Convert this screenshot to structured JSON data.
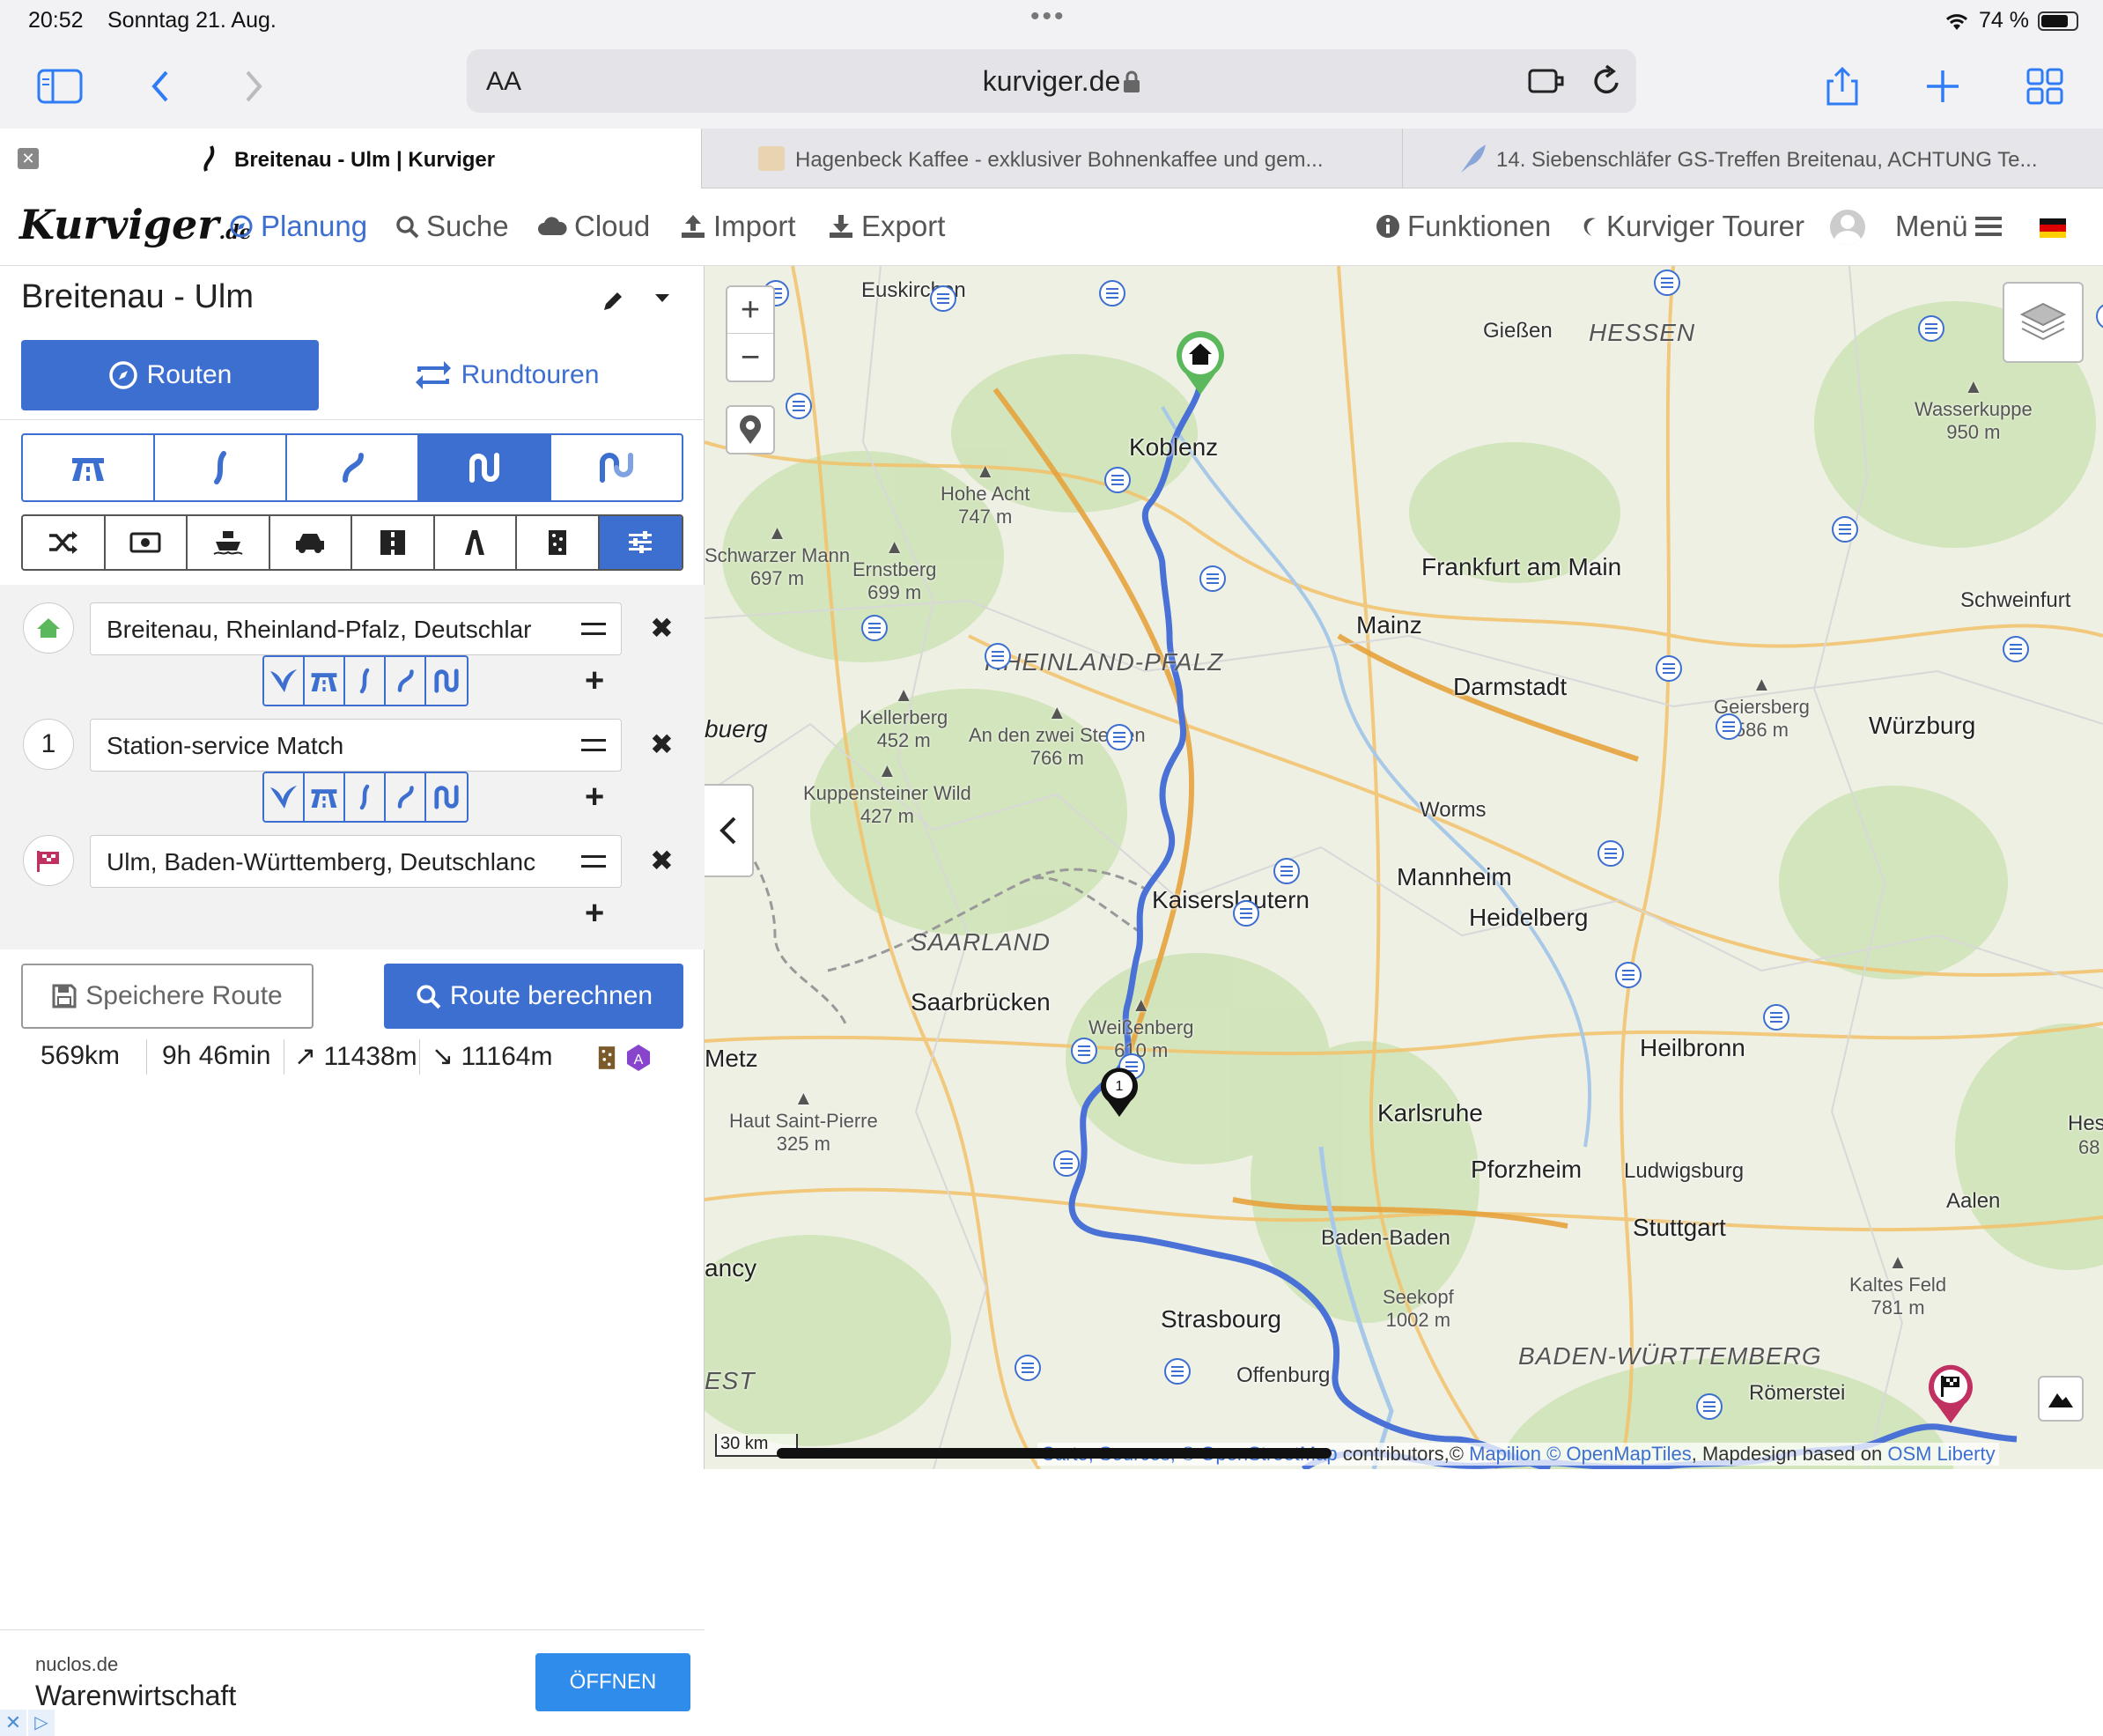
{
  "status": {
    "time": "20:52",
    "date": "Sonntag 21. Aug.",
    "battery": "74 %"
  },
  "browser": {
    "aa": "AA",
    "host": "kurviger.de"
  },
  "tabs": [
    {
      "label": "Breitenau - Ulm | Kurviger"
    },
    {
      "label": "Hagenbeck Kaffee - exklusiver Bohnenkaffee und gem..."
    },
    {
      "label": "14. Siebenschläfer GS-Treffen Breitenau, ACHTUNG Te..."
    }
  ],
  "app": {
    "logo": "Kurviger",
    "logo_suffix": ".de",
    "nav": {
      "planung": "Planung",
      "suche": "Suche",
      "cloud": "Cloud",
      "import": "Import",
      "export": "Export",
      "funktionen": "Funktionen",
      "tourer": "Kurviger Tourer",
      "menu": "Menü"
    }
  },
  "panel": {
    "title": "Breitenau - Ulm",
    "routen": "Routen",
    "rundtouren": "Rundtouren",
    "waypoints": [
      {
        "marker": "",
        "value": "Breitenau, Rheinland-Pfalz, Deutschlar"
      },
      {
        "marker": "1",
        "value": "Station-service Match"
      },
      {
        "marker": "",
        "value": "Ulm, Baden-Württemberg, Deutschlanc"
      }
    ],
    "save": "Speichere Route",
    "calc": "Route berechnen",
    "stats": {
      "distance": "569km",
      "duration": "9h 46min",
      "ascent": "11438m",
      "descent": "11164m"
    }
  },
  "ad": {
    "domain": "nuclos.de",
    "title": "Warenwirtschaft",
    "cta": "ÖFFNEN"
  },
  "map": {
    "places": {
      "euskirchen": "Euskirchen",
      "giessen": "Gießen",
      "koblenz": "Koblenz",
      "frankfurt": "Frankfurt am Main",
      "mainz": "Mainz",
      "darmstadt": "Darmstadt",
      "schweinfurt": "Schweinfurt",
      "wuerzburg": "Würzburg",
      "worms": "Worms",
      "mannheim": "Mannheim",
      "heidelberg": "Heidelberg",
      "kaiserslautern": "Kaiserslautern",
      "saarbruecken": "Saarbrücken",
      "metz": "Metz",
      "heilbronn": "Heilbronn",
      "karlsruhe": "Karlsruhe",
      "pforzheim": "Pforzheim",
      "ludwigsburg": "Ludwigsburg",
      "stuttgart": "Stuttgart",
      "badenbaden": "Baden-Baden",
      "aalen": "Aalen",
      "strasbourg": "Strasbourg",
      "offenburg": "Offenburg",
      "nancy": "ancy",
      "buerg": "buerg",
      "hess": "Hess",
      "est": "EST",
      "romerstein": "Römerstei"
    },
    "regions": {
      "hessen": "HESSEN",
      "rlp": "RHEINLAND-PFALZ",
      "saarland": "SAARLAND",
      "bw": "BADEN-WÜRTTEMBERG"
    },
    "peaks": {
      "hoheacht": "Hohe Acht",
      "hoheacht_h": "747 m",
      "schwarzermann": "Schwarzer Mann",
      "schwarzermann_h": "697 m",
      "ernstberg": "Ernstberg",
      "ernstberg_h": "699 m",
      "wasserkuppe": "Wasserkuppe",
      "wasserkuppe_h": "950 m",
      "kellerberg": "Kellerberg",
      "kellerberg_h": "452 m",
      "zweisteinen": "An den zwei Steinen",
      "zweisteinen_h": "766 m",
      "geiersberg": "Geiersberg",
      "geiersberg_h": "586 m",
      "kuppensteiner": "Kuppensteiner Wild",
      "kuppensteiner_h": "427 m",
      "weissenberg": "Weißenberg",
      "weissenberg_h": "610 m",
      "hautsaint": "Haut Saint-Pierre",
      "hautsaint_h": "325 m",
      "seekopf": "Seekopf",
      "seekopf_h": "1002 m",
      "kaltesfeld": "Kaltes Feld",
      "kaltesfeld_h": "781 m",
      "hess_h": "68"
    },
    "scale": "30 km",
    "attribution": {
      "carto": "Carto, Sources, © OpenStreetMap",
      "contrib": " contributors,© ",
      "mapilion": "Mapilion",
      "omt": " © OpenMapTiles",
      "design": ", Mapdesign based on ",
      "osm": "OSM Liberty"
    },
    "zoom_in": "+",
    "zoom_out": "−",
    "via_label": "1"
  },
  "colors": {
    "accent": "#3d6fd1",
    "route": "#4a72d6",
    "start": "#5cb85c",
    "finish": "#c03060"
  }
}
